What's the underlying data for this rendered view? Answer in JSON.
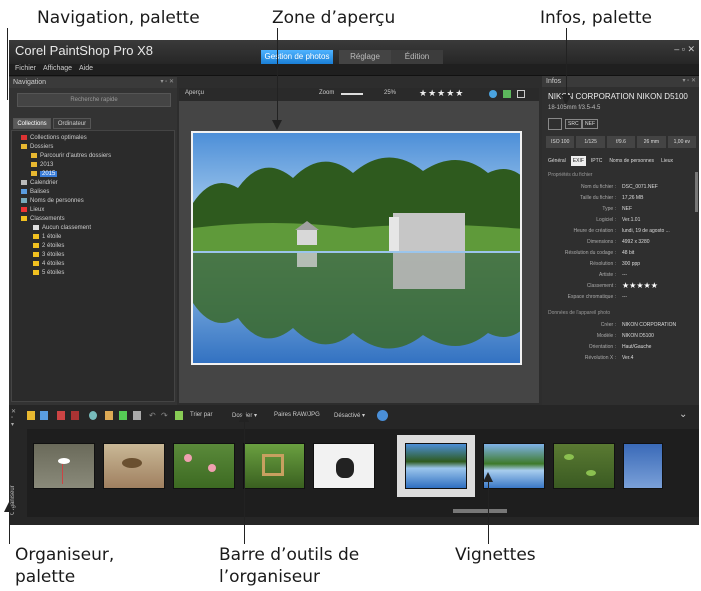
{
  "callouts": {
    "navigation": "Navigation, palette",
    "apercu": "Zone d’aperçu",
    "infos": "Infos, palette",
    "organiseur_line1": "Organiseur,",
    "organiseur_line2": "palette",
    "barre_line1": "Barre d’outils de",
    "barre_line2": "l’organiseur",
    "vignettes": "Vignettes"
  },
  "app": {
    "title": "Corel PaintShop Pro X8",
    "tabs": [
      "Gestion de photos",
      "Réglage",
      "Édition"
    ],
    "menu": [
      "Fichier",
      "Affichage",
      "Aide"
    ],
    "window_controls": "–  ▫  ✕"
  },
  "navigation": {
    "title": "Navigation",
    "search": "Recherche rapide",
    "tabs": [
      "Collections",
      "Ordinateur"
    ],
    "tree": [
      "Collections optimales",
      "Dossiers",
      "Parcourir d'autres dossiers",
      "2013",
      "2015",
      "Calendrier",
      "Balises",
      "Noms de personnes",
      "Lieux",
      "Classements",
      "Aucun classement",
      "1 étoile",
      "2 étoiles",
      "3 étoiles",
      "4 étoiles",
      "5 étoiles"
    ]
  },
  "preview": {
    "label": "Aperçu",
    "zoom_label": "Zoom",
    "zoom_value": "25%",
    "rating": "★★★★★"
  },
  "info": {
    "title": "Infos",
    "camera": "NIKON CORPORATION NIKON D5100",
    "lens": "18-105mm f/3.5-4.5",
    "badges": [
      "SRC",
      "NEF"
    ],
    "exposure": [
      "ISO 100",
      "1/125",
      "f/9.6",
      "26 mm",
      "1,00 ev"
    ],
    "tabs": [
      "Général",
      "EXIF",
      "IPTC",
      "Noms de personnes",
      "Lieux"
    ],
    "section1": "Propriétés du fichier",
    "props": [
      {
        "k": "Nom du fichier :",
        "v": "DSC_0071.NEF"
      },
      {
        "k": "Taille du fichier :",
        "v": "17,26 MB"
      },
      {
        "k": "Type :",
        "v": "NEF"
      },
      {
        "k": "Logiciel :",
        "v": "Ver.1.01"
      },
      {
        "k": "Heure de création :",
        "v": "lundi, 19 de agosto ..."
      },
      {
        "k": "Dimensions :",
        "v": "4992 x 3280"
      },
      {
        "k": "Résolution du codage :",
        "v": "48 bit"
      },
      {
        "k": "Résolution :",
        "v": "300 ppp"
      },
      {
        "k": "Artiste :",
        "v": "---"
      },
      {
        "k": "Classement :",
        "v": "★★★★★"
      },
      {
        "k": "Espace chromatique :",
        "v": "---"
      }
    ],
    "section2": "Données de l'appareil photo",
    "camera_props": [
      {
        "k": "Créer :",
        "v": "NIKON CORPORATION"
      },
      {
        "k": "Modèle :",
        "v": "NIKON D5100"
      },
      {
        "k": "Orientation :",
        "v": "Haut/Gauche"
      },
      {
        "k": "Révolution X :",
        "v": "Ver.4"
      }
    ]
  },
  "organizer": {
    "side_label": "Organiseur",
    "toolbar": {
      "trier": "Trier par",
      "dossier": "Dossier ▾",
      "paires": "Paires RAW/JPG",
      "desactive": "Désactivé ▾"
    }
  },
  "colors": {
    "accent": "#1a7fd6",
    "panel": "#333333",
    "app_bg": "#2d2d2d"
  }
}
